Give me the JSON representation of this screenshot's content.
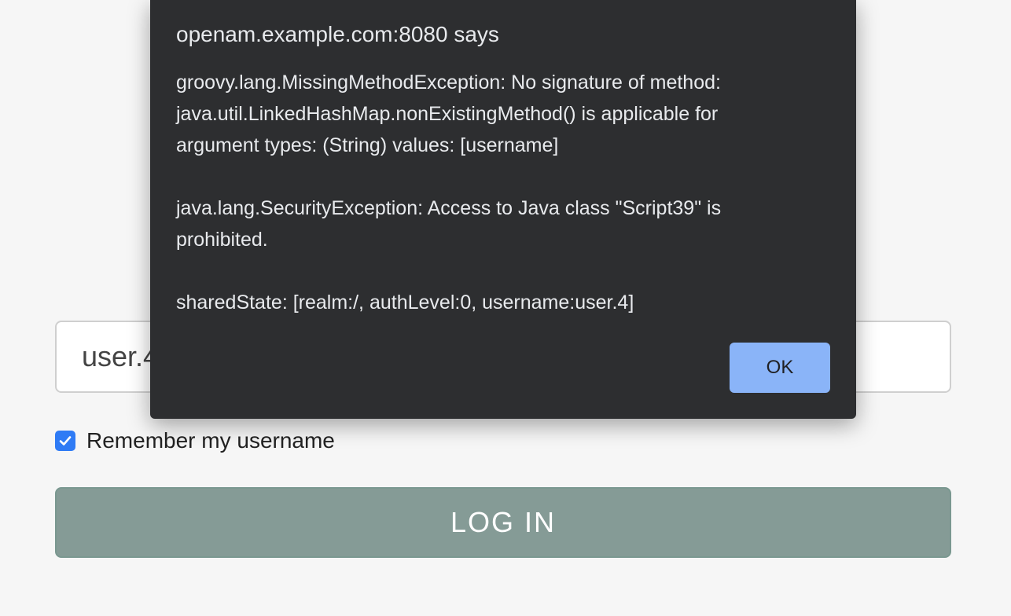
{
  "login_form": {
    "username_value": "user.4",
    "remember_label": "Remember my username",
    "remember_checked": true,
    "login_button_label": "LOG IN",
    "checkbox_color": "#2f7bf5",
    "button_color": "#859b96"
  },
  "dialog": {
    "title": "openam.example.com:8080 says",
    "message_lines": [
      "groovy.lang.MissingMethodException: No signature of method:",
      "java.util.LinkedHashMap.nonExistingMethod() is applicable for",
      "argument types: (String) values: [username]",
      "java.lang.SecurityException: Access to Java class \"Script39\" is",
      "prohibited.",
      "sharedState: [realm:/, authLevel:0, username:user.4]"
    ],
    "ok_label": "OK",
    "background_color": "#2d2e30",
    "ok_color": "#8ab4f8"
  },
  "icons": {
    "checkbox_mark": "checkmark-icon"
  }
}
